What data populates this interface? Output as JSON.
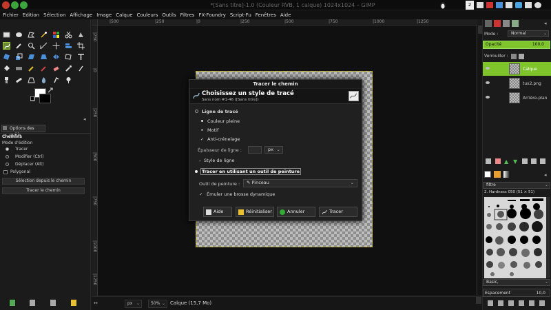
{
  "window": {
    "title": "*[Sans titre]-1.0 (Couleur RVB, 1 calque) 1024x1024 – GIMP"
  },
  "topbar": {
    "workspace_badge": "2"
  },
  "menubar": [
    "Fichier",
    "Edition",
    "Sélection",
    "Affichage",
    "Image",
    "Calque",
    "Couleurs",
    "Outils",
    "Filtres",
    "FX-Foundry",
    "Script-Fu",
    "Fenêtres",
    "Aide"
  ],
  "tool_options": {
    "tab_label": "Options des outils",
    "tool_name": "Chemins",
    "mode_label": "Mode d'édition",
    "modes": [
      "Tracer",
      "Modifier (Ctrl)",
      "Déplacer (Alt)"
    ],
    "polygonal": "Polygonal",
    "btn_from_path": "Sélection depuis le chemin",
    "btn_stroke_path": "Tracer le chemin"
  },
  "rulers": {
    "h": [
      "|500",
      "|250",
      "|0",
      "|250",
      "|500",
      "|750",
      "|1000",
      "|1250"
    ],
    "v": [
      "|250",
      "|0",
      "|250",
      "|500",
      "|750",
      "|1000",
      "|1250"
    ]
  },
  "statusbar": {
    "unit": "px",
    "zoom": "50%",
    "message": "Calque (15,7 Mo)"
  },
  "dialog": {
    "title": "Tracer le chemin",
    "heading": "Choisissez un style de tracé",
    "subheading": "Sans nom #1-46 ([Sans titre])",
    "line_option": "Ligne de tracé",
    "solid_color": "Couleur pleine",
    "pattern": "Motif",
    "antialias": "Anti-crénelage",
    "line_width": "Épaisseur de ligne :",
    "line_unit": "px",
    "line_style": "Style de ligne",
    "paint_option": "Tracer en utilisant un outil de peinture",
    "paint_tool_label": "Outil de peinture :",
    "paint_tool_value": "Pinceau",
    "emulate": "Émuler une brosse dynamique",
    "btn_help": "Aide",
    "btn_reset": "Réinitialiser",
    "btn_cancel": "Annuler",
    "btn_stroke": "Tracer"
  },
  "layers": {
    "mode_label": "Mode :",
    "mode_value": "Normal",
    "opacity_label": "Opacité",
    "opacity_value": "100,0",
    "lock_label": "Verrouiller :",
    "items": [
      {
        "name": "Calque",
        "selected": true
      },
      {
        "name": "tux2.png",
        "selected": false
      },
      {
        "name": "Arrière-plan",
        "selected": false
      }
    ],
    "accent": "#7fc42a"
  },
  "brushes": {
    "filter": "filtre",
    "current": "2. Hardness 050 (51 × 51)",
    "tag": "Basic,",
    "spacing_label": "Espacement",
    "spacing_value": "10,0"
  }
}
